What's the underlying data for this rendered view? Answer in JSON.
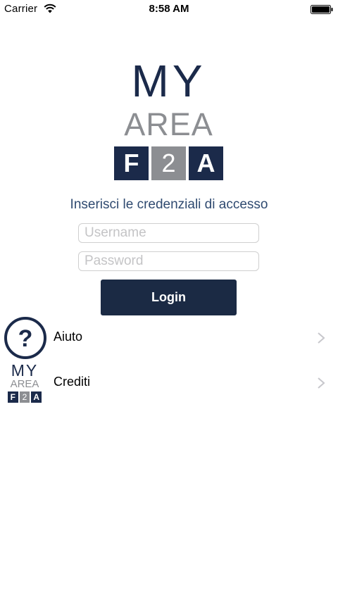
{
  "status_bar": {
    "carrier": "Carrier",
    "time": "8:58 AM",
    "wifi_icon": "wifi-icon",
    "battery_icon": "battery-full-icon"
  },
  "logo": {
    "line1": "MY",
    "line2": "AREA",
    "tiles": [
      "F",
      "2",
      "A"
    ],
    "colors": {
      "navy": "#1b2a4a",
      "grey": "#8c8e92"
    }
  },
  "login": {
    "prompt": "Inserisci le credenziali di accesso",
    "username_placeholder": "Username",
    "username_value": "",
    "password_placeholder": "Password",
    "password_value": "",
    "button_label": "Login",
    "button_color": "#1b2a44",
    "prompt_color": "#2f4a70"
  },
  "menu": {
    "items": [
      {
        "label": "Aiuto",
        "icon": "help-question-icon"
      },
      {
        "label": "Crediti",
        "icon": "my-area-f2a-logo"
      }
    ],
    "chevron_icon": "chevron-right-icon"
  }
}
